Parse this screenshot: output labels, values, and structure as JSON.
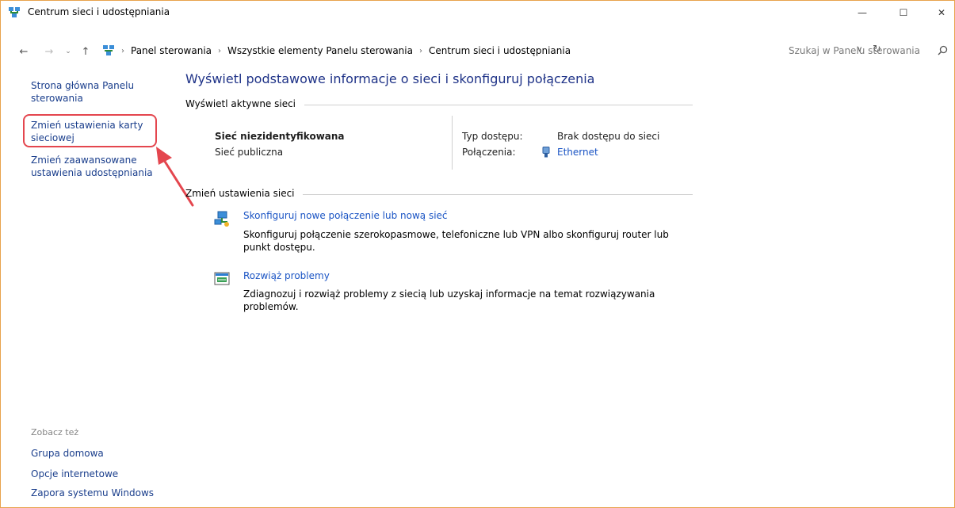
{
  "window": {
    "title": "Centrum sieci i udostępniania",
    "minimize_glyph": "—",
    "maximize_glyph": "☐",
    "close_glyph": "✕"
  },
  "address_bar": {
    "breadcrumbs": [
      "Panel sterowania",
      "Wszystkie elementy Panelu sterowania",
      "Centrum sieci i udostępniania"
    ],
    "separator": "›",
    "search_placeholder": "Szukaj w Panelu sterowania"
  },
  "sidebar": {
    "links": [
      "Strona główna Panelu sterowania",
      "Zmień ustawienia karty sieciowej",
      "Zmień zaawansowane ustawienia udostępniania"
    ],
    "see_also_label": "Zobacz też",
    "see_also_links": [
      "Grupa domowa",
      "Opcje internetowe",
      "Zapora systemu Windows"
    ]
  },
  "main": {
    "title": "Wyświetl podstawowe informacje o sieci i skonfiguruj połączenia",
    "active_networks_header": "Wyświetl aktywne sieci",
    "network": {
      "name": "Sieć niezidentyfikowana",
      "type": "Sieć publiczna",
      "access_label": "Typ dostępu:",
      "access_value": "Brak dostępu do sieci",
      "connections_label": "Połączenia:",
      "connection_value": "Ethernet"
    },
    "change_settings_header": "Zmień ustawienia sieci",
    "tasks": [
      {
        "link": "Skonfiguruj nowe połączenie lub nową sieć",
        "description": "Skonfiguruj połączenie szerokopasmowe, telefoniczne lub VPN albo skonfiguruj router lub punkt dostępu."
      },
      {
        "link": "Rozwiąż problemy",
        "description": "Zdiagnozuj i rozwiąż problemy z siecią lub uzyskaj informacje na temat rozwiązywania problemów."
      }
    ]
  },
  "colors": {
    "link": "#1a3e8c",
    "title": "#1e3287",
    "highlight": "#e4464e",
    "window_border": "#e8a34d"
  },
  "icons": [
    "network-center-icon",
    "back-arrow-icon",
    "forward-arrow-icon",
    "up-arrow-icon",
    "refresh-icon",
    "search-icon",
    "ethernet-icon",
    "new-connection-icon",
    "troubleshoot-icon"
  ]
}
